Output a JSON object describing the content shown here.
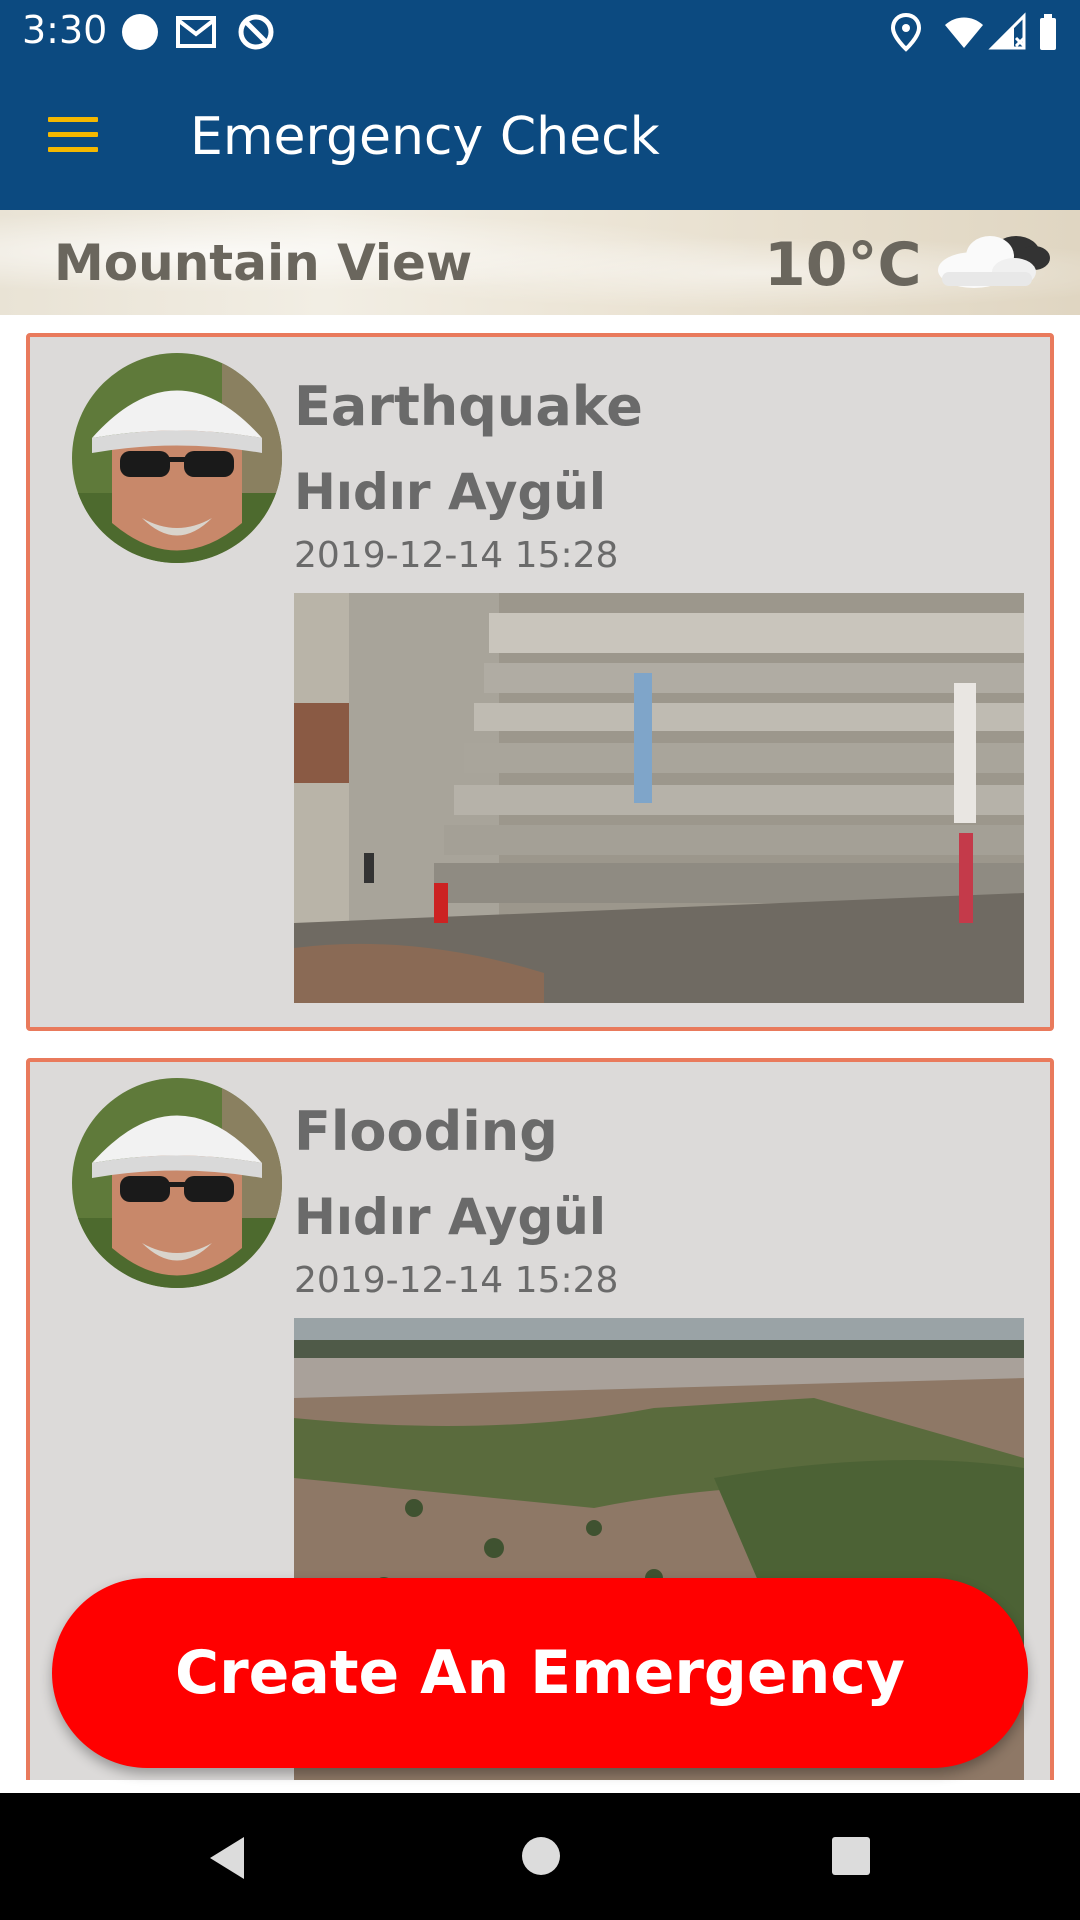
{
  "status_bar": {
    "time": "3:30",
    "left_icons": [
      "circle-icon",
      "gmail-icon",
      "sync-icon"
    ],
    "right_icons": [
      "location-icon",
      "wifi-icon",
      "signal-icon",
      "battery-icon"
    ]
  },
  "app_bar": {
    "title": "Emergency Check",
    "menu_icon": "hamburger-menu-icon",
    "color": "#0c4a80",
    "accent": "#f5b800"
  },
  "weather": {
    "city": "Mountain View",
    "temperature": "10°C",
    "icon": "cloud-icon"
  },
  "emergencies": [
    {
      "type": "Earthquake",
      "user": "Hıdır Aygül",
      "datetime": "2019-12-14 15:28",
      "photo": "collapsed-building-photo"
    },
    {
      "type": "Flooding",
      "user": "Hıdır Aygül",
      "datetime": "2019-12-14 15:28",
      "photo": "flooded-landscape-photo"
    }
  ],
  "card_border_color": "#e97a5c",
  "create_button": {
    "label": "Create An Emergency",
    "color": "#ff0000"
  },
  "nav_bar": {
    "buttons": [
      "back-icon",
      "home-icon",
      "recents-icon"
    ]
  }
}
